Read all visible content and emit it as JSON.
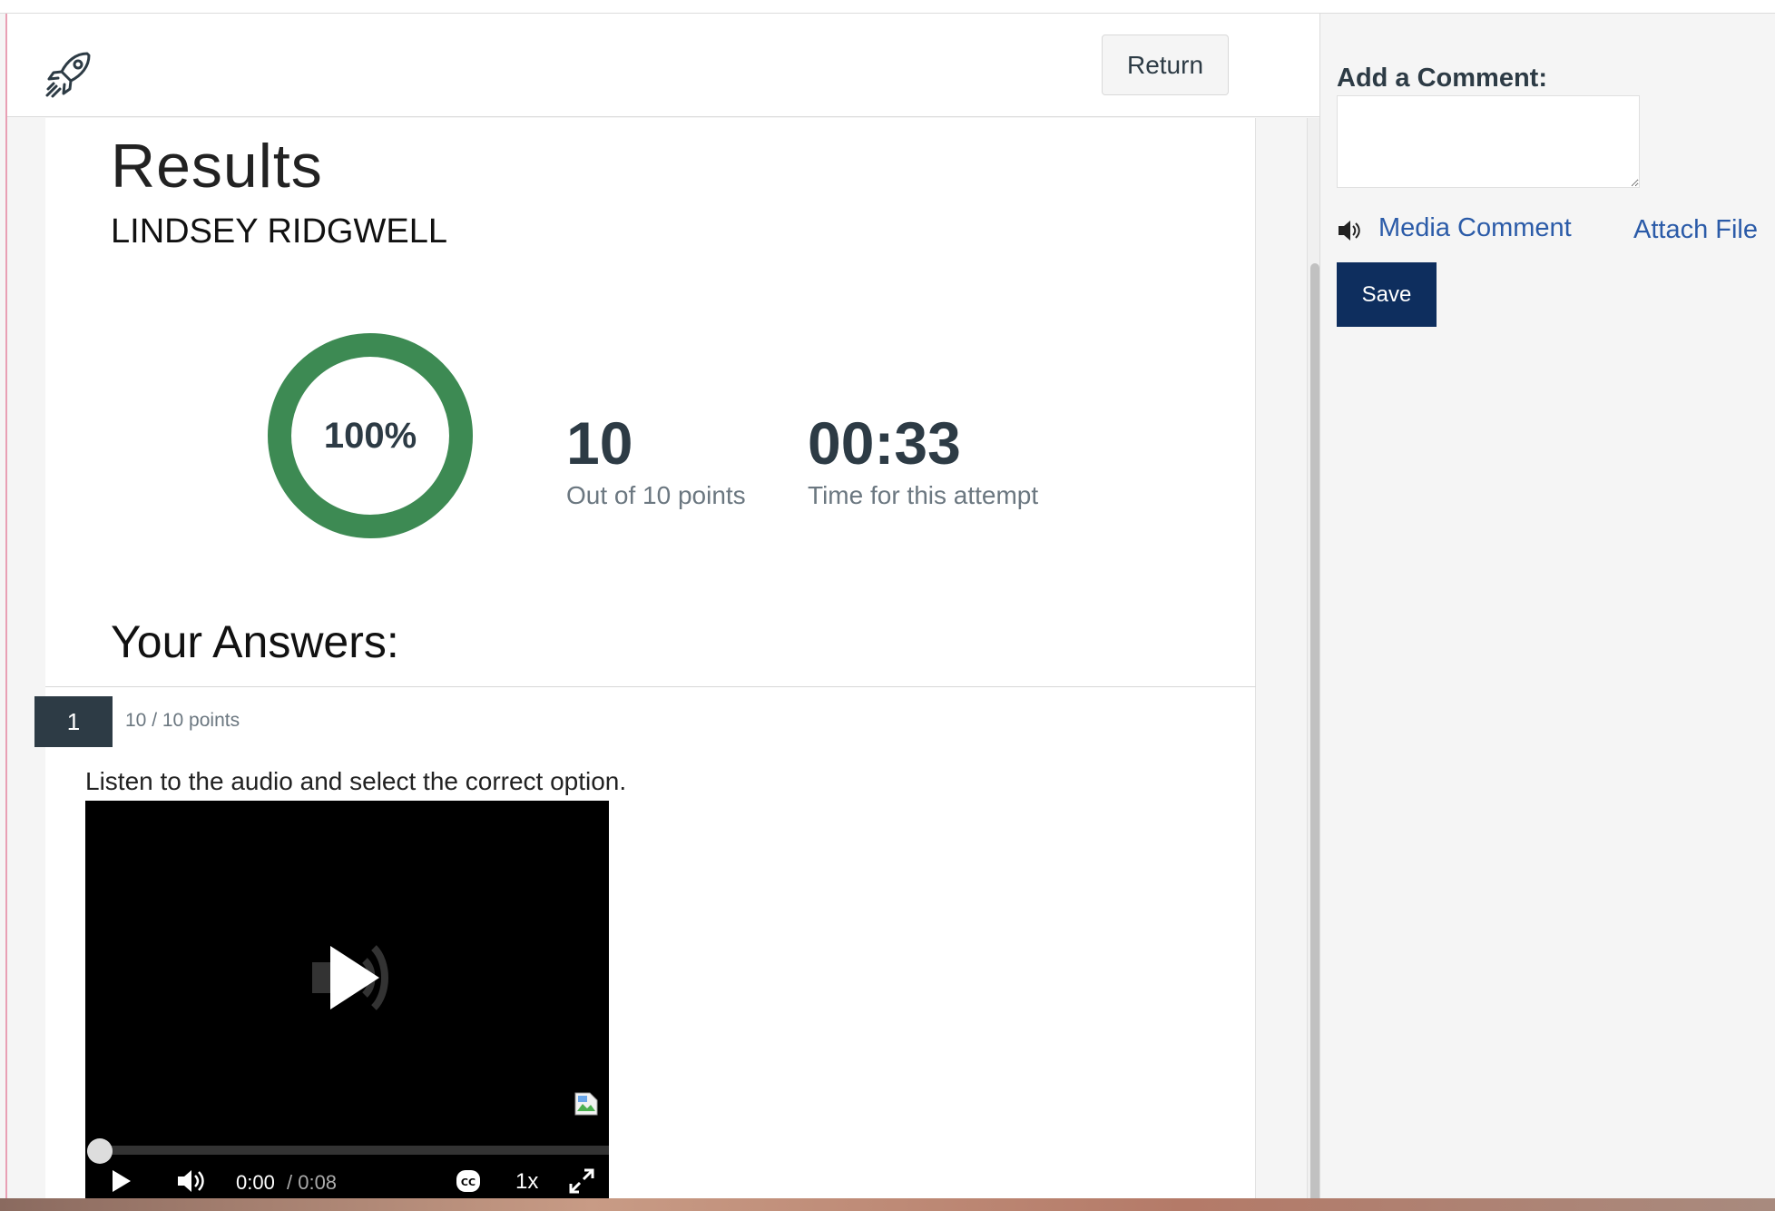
{
  "header": {
    "return_label": "Return"
  },
  "results": {
    "title": "Results",
    "student_name": "LINDSEY RIDGWELL",
    "score_percent_text": "100%",
    "score_percent_value": 100,
    "score_value": "10",
    "score_sub": "Out of 10 points",
    "time_value": "00:33",
    "time_sub": "Time for this attempt",
    "accent_color": "#3d8a53"
  },
  "answers": {
    "heading": "Your Answers:",
    "question_number": "1",
    "question_points": "10 / 10 points",
    "question_text": "Listen to the audio and select the correct option.",
    "player": {
      "current_time": "0:00",
      "duration": "/ 0:08",
      "speed": "1x",
      "progress_fraction": 0
    }
  },
  "comment": {
    "label": "Add a Comment:",
    "value": "",
    "media_comment": "Media Comment",
    "attach_file": "Attach File",
    "save_label": "Save",
    "save_color": "#0e2e5e"
  }
}
